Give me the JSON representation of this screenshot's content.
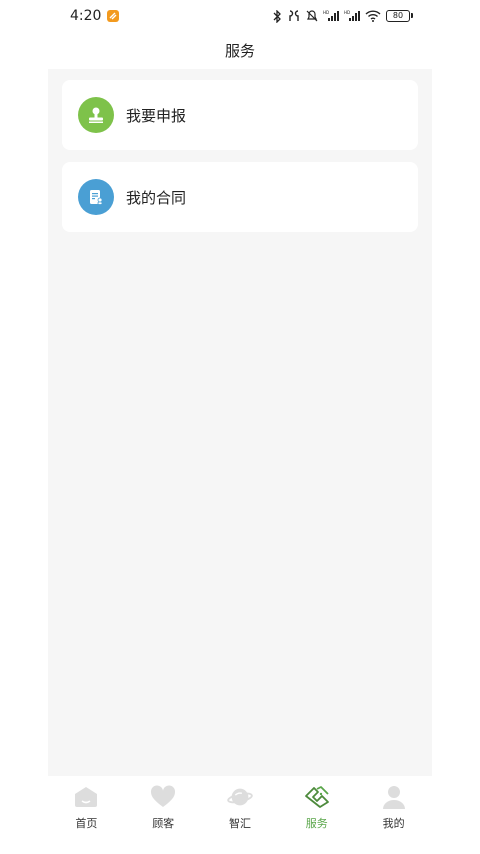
{
  "status_bar": {
    "time": "4:20",
    "battery": "80"
  },
  "header": {
    "title": "服务"
  },
  "cards": [
    {
      "label": "我要申报",
      "icon": "stamp-icon",
      "color": "#7ec24a"
    },
    {
      "label": "我的合同",
      "icon": "contract-icon",
      "color": "#4a9fd4"
    }
  ],
  "tabs": [
    {
      "label": "首页",
      "icon": "home-icon",
      "active": false
    },
    {
      "label": "顾客",
      "icon": "heart-icon",
      "active": false
    },
    {
      "label": "智汇",
      "icon": "planet-icon",
      "active": false
    },
    {
      "label": "服务",
      "icon": "handshake-icon",
      "active": true
    },
    {
      "label": "我的",
      "icon": "person-icon",
      "active": false
    }
  ],
  "colors": {
    "accent": "#5aa64a",
    "content_bg": "#f6f6f6",
    "inactive_icon": "#dddddd"
  }
}
